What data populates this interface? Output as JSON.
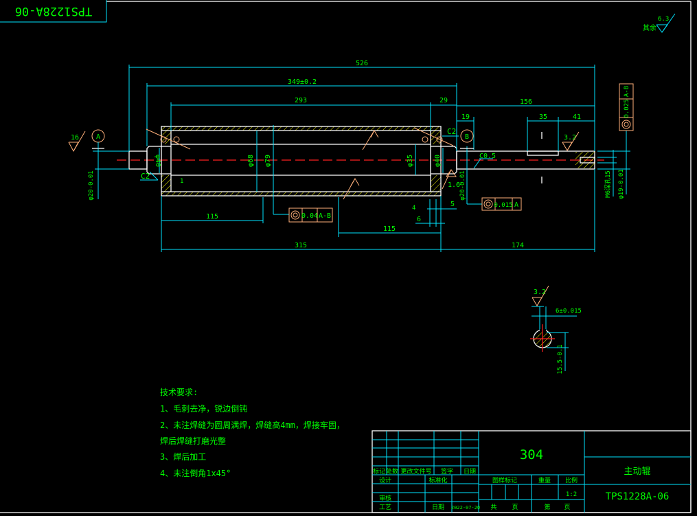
{
  "drawing": {
    "corner_code": "TPS1228A-06",
    "roughness_rest_label": "其余",
    "roughness_rest_value": "6.3",
    "dims": {
      "overall": "526",
      "tube_length": "349±0.2",
      "bore_length": "293",
      "end_29": "29",
      "right_shaft": "156",
      "shoulder_19": "19",
      "key_35": "35",
      "end_41": "41",
      "left_115": "115",
      "right_115": "115",
      "total_315": "315",
      "right_174": "174",
      "dim_5": "5",
      "dim_6": "6",
      "dia_left_shaft": "φ20-0.01",
      "dia_40_left": "φ40",
      "dia_68": "φ68",
      "dia_79": "φ79",
      "dia_35": "φ35",
      "dia_40_right": "φ40",
      "dia_right_bearing": "φ20-0.01",
      "thread": "M6深孔15",
      "dia_right_end": "φ19-0.01",
      "chamfer_left": "C2",
      "chamfer_right": "C2",
      "chamfer_c05": "C0.5",
      "weld_1": "1",
      "weld_4": "4"
    },
    "roughness": {
      "left": "16",
      "right_shaft": "3.2",
      "bearing": "1.6",
      "section": "3.2"
    },
    "datums": {
      "a": "A",
      "b": "B"
    },
    "tolerance_frames": [
      {
        "symbol": "concentricity",
        "value": "0.04",
        "datum": "A-B"
      },
      {
        "symbol": "concentricity",
        "value": "0.015",
        "datum": "A"
      },
      {
        "symbol": "concentricity",
        "value": "0.025",
        "datum": "A-B"
      }
    ],
    "section": {
      "key_width": "6±0.015",
      "depth": "15.5-0.1"
    },
    "colors": {
      "background": "#000000",
      "lines": "#00e5ff",
      "text": "#00ff00",
      "outline": "#ffffff",
      "centerline": "#ff2020",
      "hatch": "#ffff00",
      "symbols": "#ffb07a"
    }
  },
  "notes": {
    "title": "技术要求:",
    "items": [
      "1、毛刺去净，锐边倒钝",
      "2、未注焊缝为圆周满焊，焊缝高4mm，焊接牢固，",
      "焊后焊缝打磨光整",
      "3、焊后加工",
      "4、未注倒角1x45°"
    ]
  },
  "title_block": {
    "material": "304",
    "part_name": "主动辊",
    "drawing_number": "TPS1228A-06",
    "headers": [
      "标记",
      "处数",
      "更改文件号",
      "签字",
      "日期"
    ],
    "design": "设计",
    "standardize": "标准化",
    "review": "审核",
    "process": "工艺",
    "date_label": "日期",
    "date": "2022-07-20",
    "stage_mark": "图样标记",
    "weight": "重量",
    "scale_label": "比例",
    "scale": "1:2",
    "total": "共",
    "sheet_unit": "页",
    "sheet_no": "第",
    "sheet_unit2": "页"
  }
}
